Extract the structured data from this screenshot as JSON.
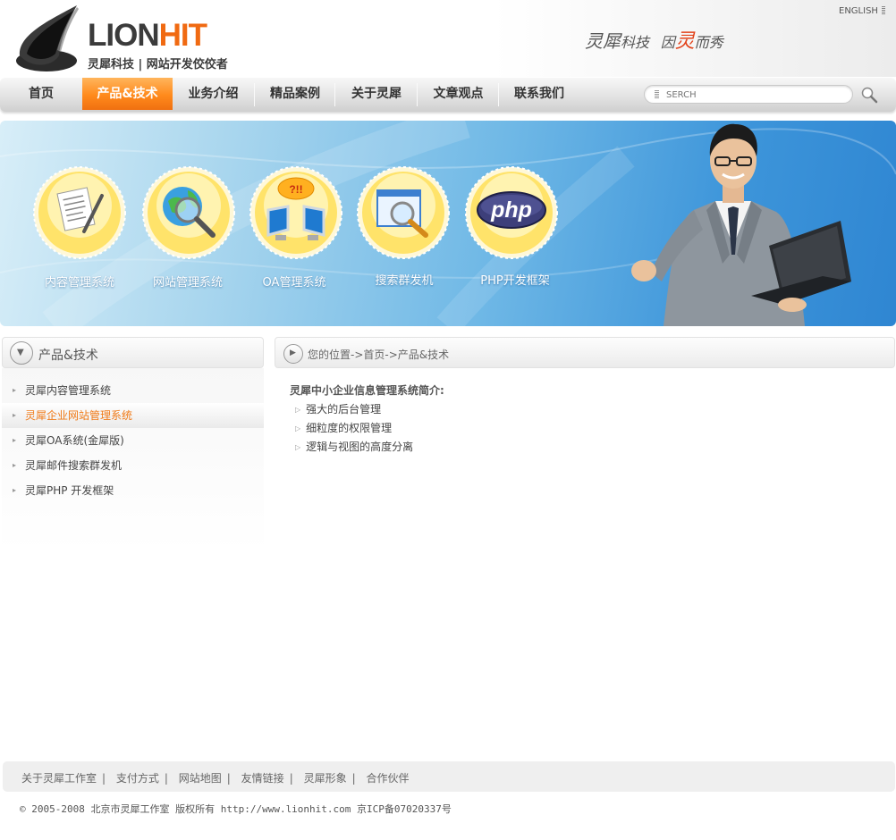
{
  "header": {
    "logo_main": "LION",
    "logo_accent": "HIT",
    "logo_sub": "灵犀科技 | 网站开发佼佼者",
    "slogan_part1": "灵犀",
    "slogan_part2": "科技",
    "slogan_part3": "因",
    "slogan_highlight": "灵",
    "slogan_part4": "而秀",
    "lang_link": "ENGLISH"
  },
  "nav": {
    "items": [
      {
        "label": "首页"
      },
      {
        "label": "产品&技术"
      },
      {
        "label": "业务介绍"
      },
      {
        "label": "精品案例"
      },
      {
        "label": "关于灵犀"
      },
      {
        "label": "文章观点"
      },
      {
        "label": "联系我们"
      }
    ],
    "active_index": 1,
    "search_placeholder": "SERCH"
  },
  "banner": {
    "badges": [
      {
        "label": "内容管理系统",
        "icon": "document-pen-icon"
      },
      {
        "label": "网站管理系统",
        "icon": "globe-magnifier-icon"
      },
      {
        "label": "OA管理系统",
        "icon": "network-computers-icon"
      },
      {
        "label": "搜索群发机",
        "icon": "search-window-icon"
      },
      {
        "label": "PHP开发框架",
        "icon": "php-logo-icon"
      }
    ],
    "php_text": "php",
    "oa_bubble_text": "?!!"
  },
  "sidebar": {
    "title": "产品&技术",
    "items": [
      {
        "label": "灵犀内容管理系统"
      },
      {
        "label": "灵犀企业网站管理系统"
      },
      {
        "label": "灵犀OA系统(金犀版)"
      },
      {
        "label": "灵犀邮件搜索群发机"
      },
      {
        "label": "灵犀PHP 开发框架"
      }
    ],
    "active_index": 1
  },
  "main": {
    "breadcrumb": "您的位置->首页->产品&技术",
    "intro_title": "灵犀中小企业信息管理系统简介:",
    "features": [
      {
        "label": "强大的后台管理"
      },
      {
        "label": "细粒度的权限管理"
      },
      {
        "label": "逻辑与视图的高度分离"
      }
    ]
  },
  "footer": {
    "links": [
      {
        "label": "关于灵犀工作室"
      },
      {
        "label": "支付方式"
      },
      {
        "label": "网站地图"
      },
      {
        "label": "友情链接"
      },
      {
        "label": "灵犀形象"
      },
      {
        "label": "合作伙伴"
      }
    ],
    "separator": "|",
    "copyright": "© 2005-2008 北京市灵犀工作室 版权所有 http://www.lionhit.com 京ICP备07020337号"
  },
  "colors": {
    "accent_orange": "#f07a18",
    "nav_active": "#ff8a1c",
    "banner_blue": "#3d95da"
  }
}
